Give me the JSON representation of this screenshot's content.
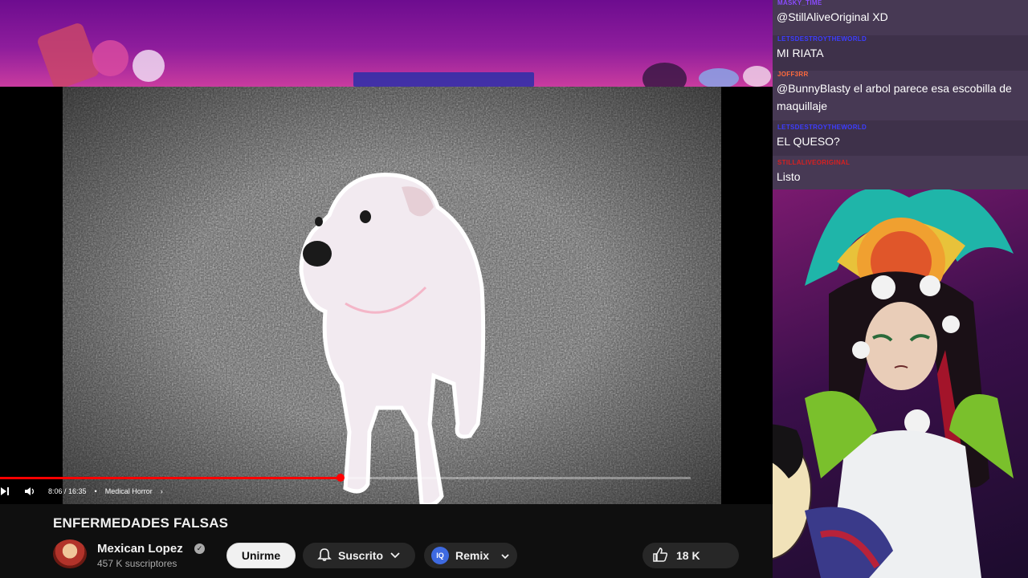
{
  "video": {
    "time": "8:06 / 16:35",
    "chapter": "Medical Horror",
    "progress_fraction": 0.493
  },
  "page": {
    "title": "ENFERMEDADES FALSAS",
    "channel_name": "Mexican Lopez",
    "subscribers": "457 K suscriptores",
    "join_label": "Unirme",
    "subscribed_label": "Suscrito",
    "remix_label": "Remix",
    "likes": "18 K"
  },
  "chat": [
    {
      "user": "MASKY_TIME",
      "text": "@StillAliveOriginal XD",
      "user_color": "#8a4bff"
    },
    {
      "user": "LETSDESTROYTHEWORLD",
      "text": "MI RIATA",
      "user_color": "#3d3dff"
    },
    {
      "user": "JOFF3RR",
      "text": "@BunnyBlasty el arbol parece esa escobilla de maquillaje",
      "user_color": "#ff6a3d"
    },
    {
      "user": "LETSDESTROYTHEWORLD",
      "text": "EL QUESO?",
      "user_color": "#3d3dff"
    },
    {
      "user": "STILLALIVEORIGINAL",
      "text": "Listo",
      "user_color": "#d82020"
    }
  ],
  "colors": {
    "progress": "#ff0000",
    "page_bg": "#0f0f0f",
    "chat_bg": "#483a54"
  }
}
